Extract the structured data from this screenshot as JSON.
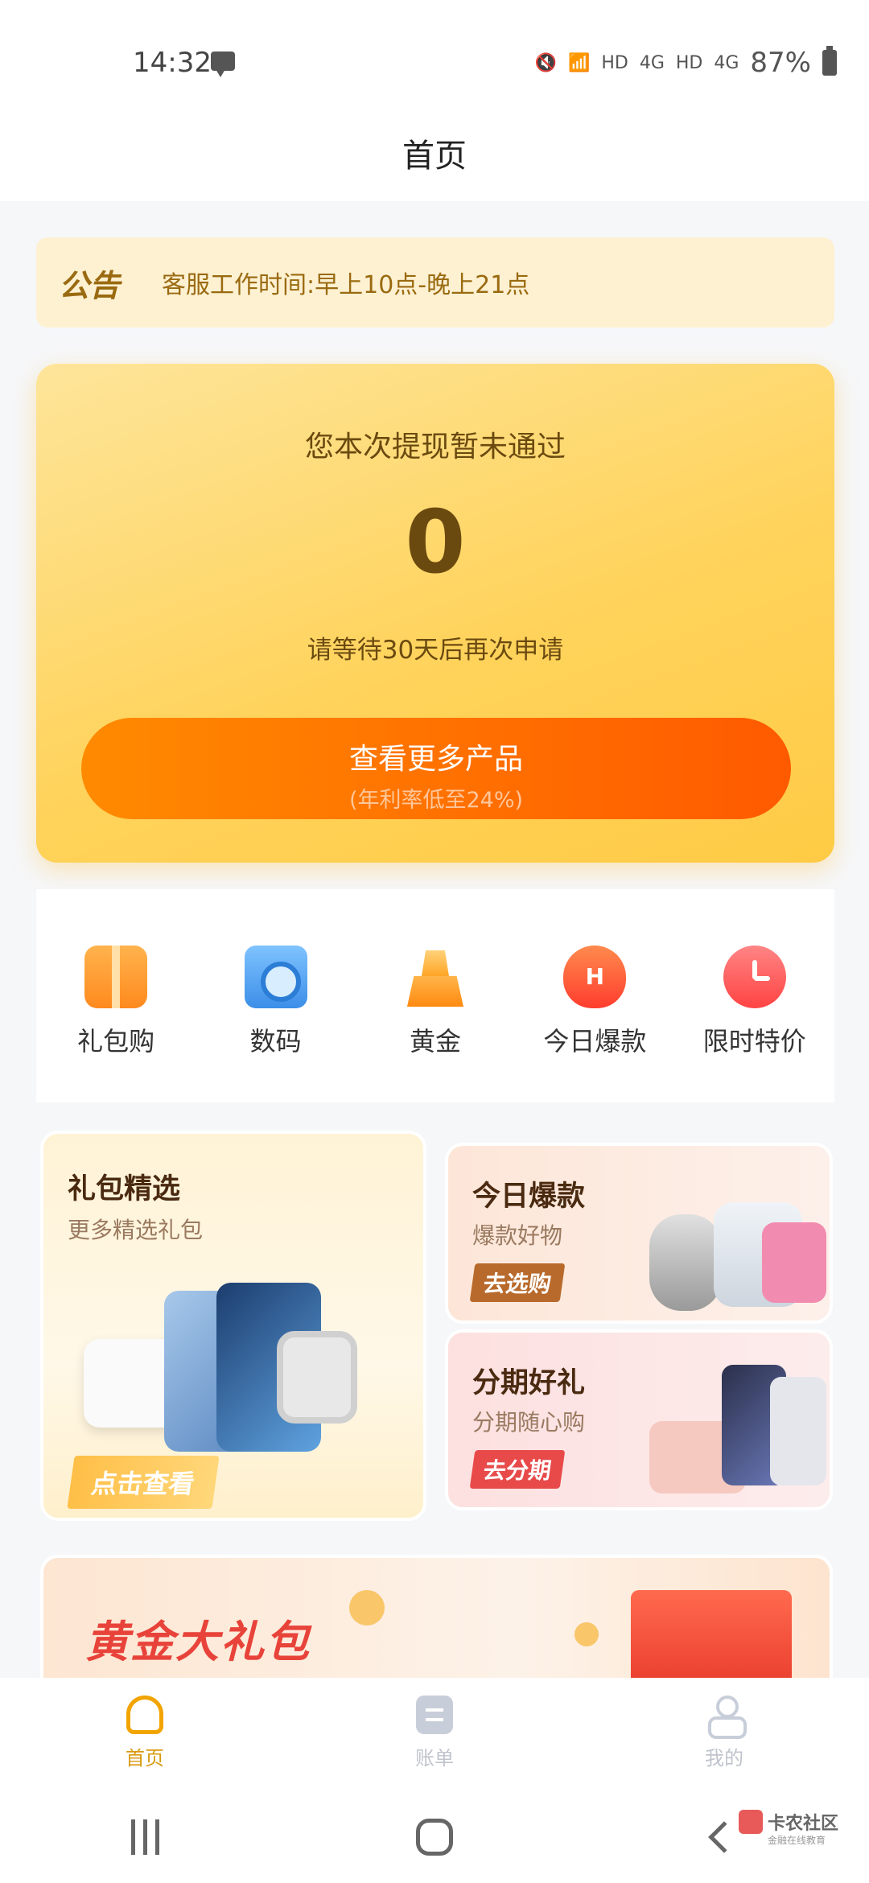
{
  "status": {
    "time": "14:32",
    "hd1": "HD",
    "net1": "4G",
    "hd2": "HD",
    "net2": "4G",
    "battery": "87%"
  },
  "header": {
    "title": "首页"
  },
  "notice": {
    "tag": "公告",
    "text": "客服工作时间:早上10点-晚上21点"
  },
  "card": {
    "status_text": "您本次提现暂未通过",
    "amount": "0",
    "wait_text": "请等待30天后再次申请",
    "button_label": "查看更多产品",
    "button_sub": "(年利率低至24%)"
  },
  "categories": [
    {
      "label": "礼包购",
      "icon": "gift-icon"
    },
    {
      "label": "数码",
      "icon": "camera-icon"
    },
    {
      "label": "黄金",
      "icon": "gold-bar-icon"
    },
    {
      "label": "今日爆款",
      "icon": "fire-icon"
    },
    {
      "label": "限时特价",
      "icon": "alarm-clock-icon"
    }
  ],
  "promos": {
    "left": {
      "title": "礼包精选",
      "subtitle": "更多精选礼包",
      "button": "点击查看"
    },
    "right_top": {
      "title": "今日爆款",
      "subtitle": "爆款好物",
      "button": "去选购"
    },
    "right_bottom": {
      "title": "分期好礼",
      "subtitle": "分期随心购",
      "button": "去分期"
    }
  },
  "banner": {
    "title": "黄金大礼包"
  },
  "tabbar": [
    {
      "label": "首页",
      "active": true
    },
    {
      "label": "账单",
      "active": false
    },
    {
      "label": "我的",
      "active": false
    }
  ],
  "watermark": {
    "title": "卡农社区",
    "subtitle": "金融在线教育"
  },
  "colors": {
    "accent": "#ff6a00",
    "gold": "#ffd35c",
    "brown": "#6b4a10",
    "tab_active": "#f2a400"
  }
}
